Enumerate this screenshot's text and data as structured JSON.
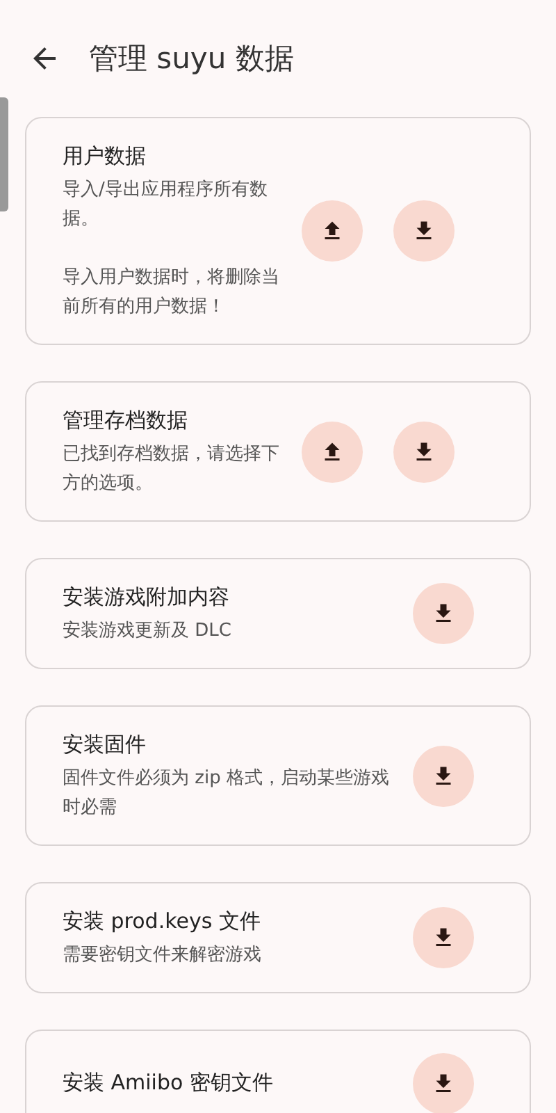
{
  "app_bar": {
    "title": "管理 suyu 数据"
  },
  "cards": [
    {
      "title": "用户数据",
      "description": [
        "导入/导出应用程序所有数据。",
        "导入用户数据时，将删除当前所有的用户数据！"
      ],
      "buttons": [
        {
          "kind": "import"
        },
        {
          "kind": "export"
        }
      ]
    },
    {
      "title": "管理存档数据",
      "description": [
        "已找到存档数据，请选择下方的选项。"
      ],
      "buttons": [
        {
          "kind": "import"
        },
        {
          "kind": "export"
        }
      ]
    },
    {
      "title": "安装游戏附加内容",
      "description": [
        "安装游戏更新及 DLC"
      ],
      "buttons": [
        {
          "kind": "export"
        }
      ]
    },
    {
      "title": "安装固件",
      "description": [
        "固件文件必须为 zip 格式，启动某些游戏时必需"
      ],
      "buttons": [
        {
          "kind": "export"
        }
      ]
    },
    {
      "title": "安装 prod.keys 文件",
      "description": [
        "需要密钥文件来解密游戏"
      ],
      "buttons": [
        {
          "kind": "export"
        }
      ]
    },
    {
      "title": "安装 Amiibo 密钥文件",
      "buttons": [
        {
          "kind": "export"
        }
      ]
    }
  ]
}
